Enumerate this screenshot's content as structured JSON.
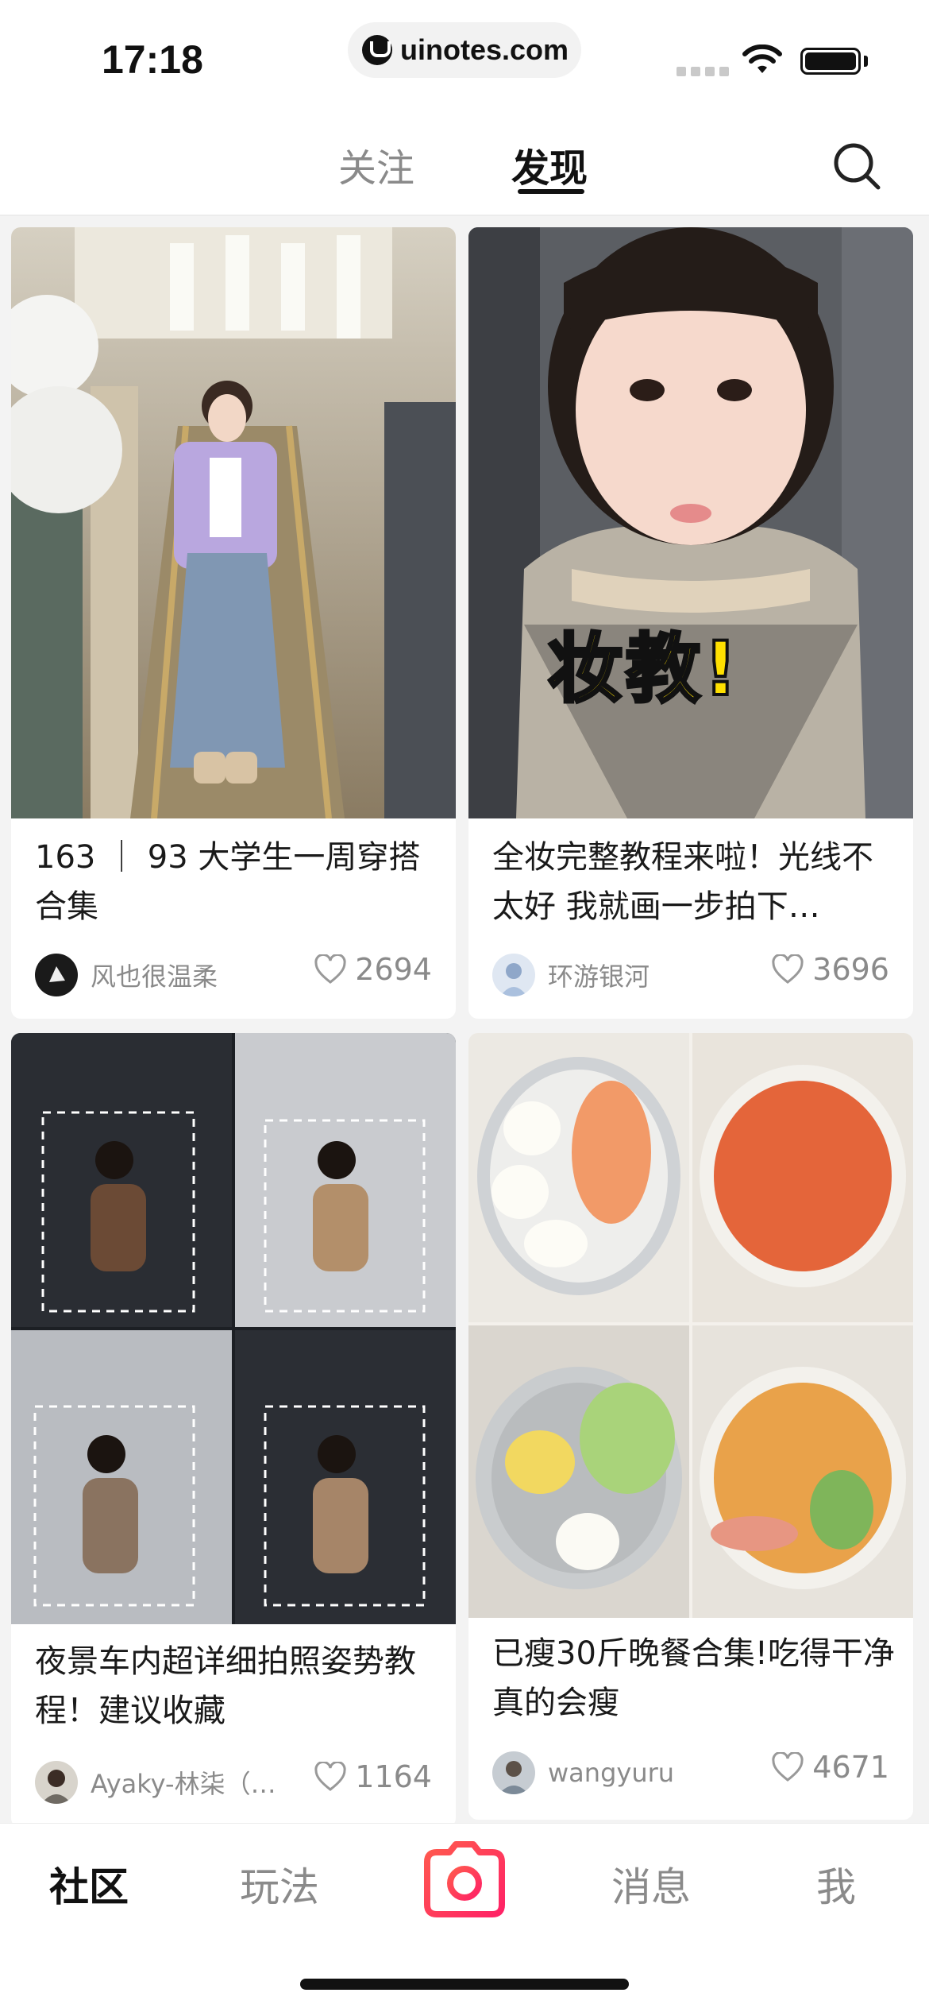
{
  "status_bar": {
    "time": "17:18",
    "url": "uinotes.com"
  },
  "header": {
    "tabs": [
      {
        "label": "关注",
        "active": false
      },
      {
        "label": "发现",
        "active": true
      }
    ],
    "search_icon": "search-icon"
  },
  "feed": {
    "cards": [
      {
        "title": "163 ｜ 93 大学生一周穿搭合集",
        "author": "风也很温柔",
        "likes": "2694"
      },
      {
        "title": "全妆完整教程来啦！光线不太好 我就画一步拍下…",
        "author": "环游银河",
        "likes": "3696",
        "image_text": "妆教!"
      },
      {
        "title": "夜景车内超详细拍照姿势教程！建议收藏",
        "author": "Ayaky-林柒（…",
        "likes": "1164"
      },
      {
        "title": "已瘦30斤晚餐合集!吃得干净真的会瘦",
        "author": "wangyuru",
        "likes": "4671"
      }
    ]
  },
  "bottom_nav": {
    "items": [
      "社区",
      "玩法",
      "消息",
      "我"
    ],
    "active": "社区",
    "camera_icon": "camera-icon"
  },
  "colors": {
    "accent": "#ff2442",
    "text_primary": "#1a1a1a",
    "text_secondary": "#8a8a8a",
    "background": "#f3f3f3"
  }
}
